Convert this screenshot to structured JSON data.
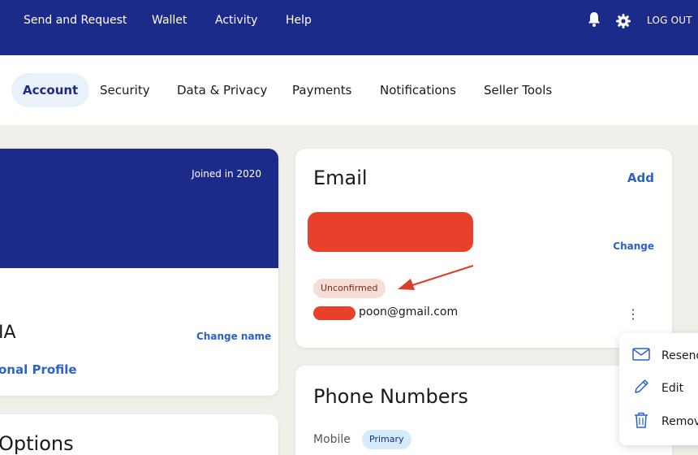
{
  "topnav": {
    "items": [
      "Send and Request",
      "Wallet",
      "Activity",
      "Help"
    ],
    "logout_label": "LOG OUT",
    "icons": [
      "bell-icon",
      "gear-icon"
    ]
  },
  "subnav": {
    "tabs": [
      {
        "label": "Account",
        "active": true
      },
      {
        "label": "Security",
        "active": false
      },
      {
        "label": "Data & Privacy",
        "active": false
      },
      {
        "label": "Payments",
        "active": false
      },
      {
        "label": "Notifications",
        "active": false
      },
      {
        "label": "Seller Tools",
        "active": false
      }
    ]
  },
  "profile": {
    "joined": "Joined in 2020",
    "name_fragment": "IA",
    "change_name": "Change name",
    "profile_link": "onal Profile"
  },
  "options_card": {
    "title": "Options"
  },
  "email_card": {
    "title": "Email",
    "add": "Add",
    "change": "Change",
    "unconfirmed_badge": "Unconfirmed",
    "second_email_visible": "poon@gmail.com"
  },
  "context_menu": {
    "items": [
      {
        "label": "Resend",
        "icon": "mail-icon"
      },
      {
        "label": "Edit",
        "icon": "pencil-icon"
      },
      {
        "label": "Remove",
        "icon": "trash-icon"
      }
    ]
  },
  "phone_card": {
    "title": "Phone Numbers",
    "type_label": "Mobile",
    "primary_badge": "Primary"
  },
  "colors": {
    "navy": "#1c2a8a",
    "link": "#2b62c9",
    "redaction": "#e8402a",
    "annotation_arrow": "#d8402a",
    "page_bg": "#f1efea"
  }
}
